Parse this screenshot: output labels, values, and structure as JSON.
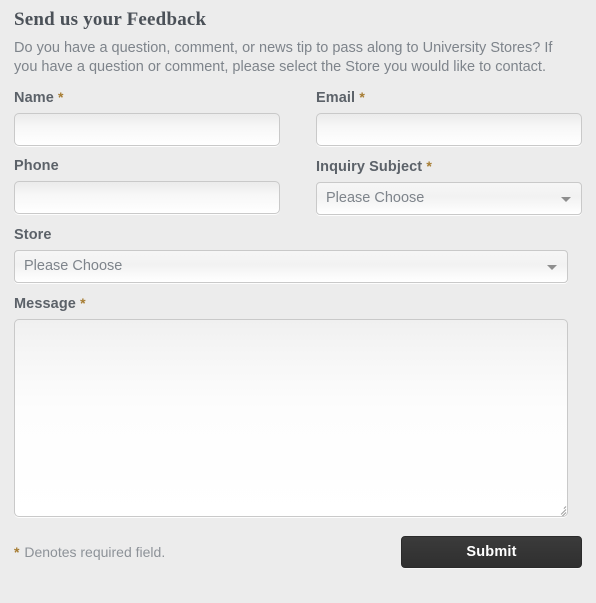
{
  "form": {
    "title": "Send us your Feedback",
    "intro": "Do you have a question, comment, or news tip to pass along to University Stores? If you have a question or comment, please select the Store you would like to contact.",
    "required_marker": "*",
    "fields": {
      "name": {
        "label": "Name",
        "required": true,
        "value": "",
        "placeholder": ""
      },
      "email": {
        "label": "Email",
        "required": true,
        "value": "",
        "placeholder": ""
      },
      "phone": {
        "label": "Phone",
        "required": false,
        "value": "",
        "placeholder": ""
      },
      "inquiry_subject": {
        "label": "Inquiry Subject",
        "required": true,
        "selected": "Please Choose",
        "arrow_icon": "chevron-down-icon"
      },
      "store": {
        "label": "Store",
        "required": false,
        "selected": "Please Choose",
        "arrow_icon": "chevron-down-icon"
      },
      "message": {
        "label": "Message",
        "required": true,
        "value": "",
        "placeholder": "",
        "resize_icon": "resize-grip-icon"
      }
    },
    "footer": {
      "denotes_text": "Denotes required field.",
      "submit_label": "Submit"
    },
    "colors": {
      "page_background": "#ececec",
      "required_asterisk": "#a67c32",
      "label_text": "#5c6269",
      "body_text": "#7e848b",
      "heading_text": "#4b5158",
      "input_border": "#c9c9c9",
      "submit_background": "#353535",
      "submit_text": "#ffffff"
    }
  }
}
